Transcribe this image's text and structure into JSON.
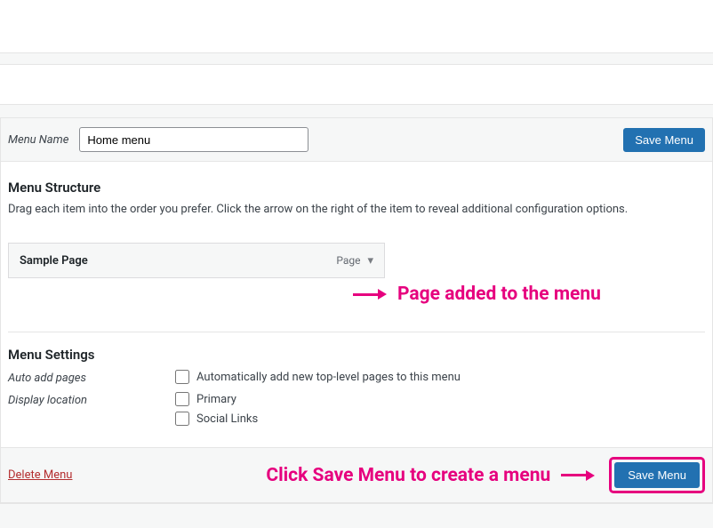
{
  "name_row": {
    "label": "Menu Name",
    "value": "Home menu",
    "save_label": "Save Menu"
  },
  "structure": {
    "heading": "Menu Structure",
    "desc": "Drag each item into the order you prefer. Click the arrow on the right of the item to reveal additional configuration options.",
    "items": [
      {
        "title": "Sample Page",
        "type": "Page"
      }
    ]
  },
  "annotations": {
    "page_added": "Page added to the menu",
    "click_save": "Click Save Menu to create a menu"
  },
  "settings": {
    "heading": "Menu Settings",
    "auto_label": "Auto add pages",
    "auto_check": "Automatically add new top-level pages to this menu",
    "display_label": "Display location",
    "locations": [
      {
        "label": "Primary"
      },
      {
        "label": "Social Links"
      }
    ]
  },
  "bottom": {
    "delete": "Delete Menu",
    "save_label": "Save Menu"
  },
  "colors": {
    "primary": "#2271b1",
    "annotation": "#e6007e",
    "danger": "#b32d2e"
  }
}
